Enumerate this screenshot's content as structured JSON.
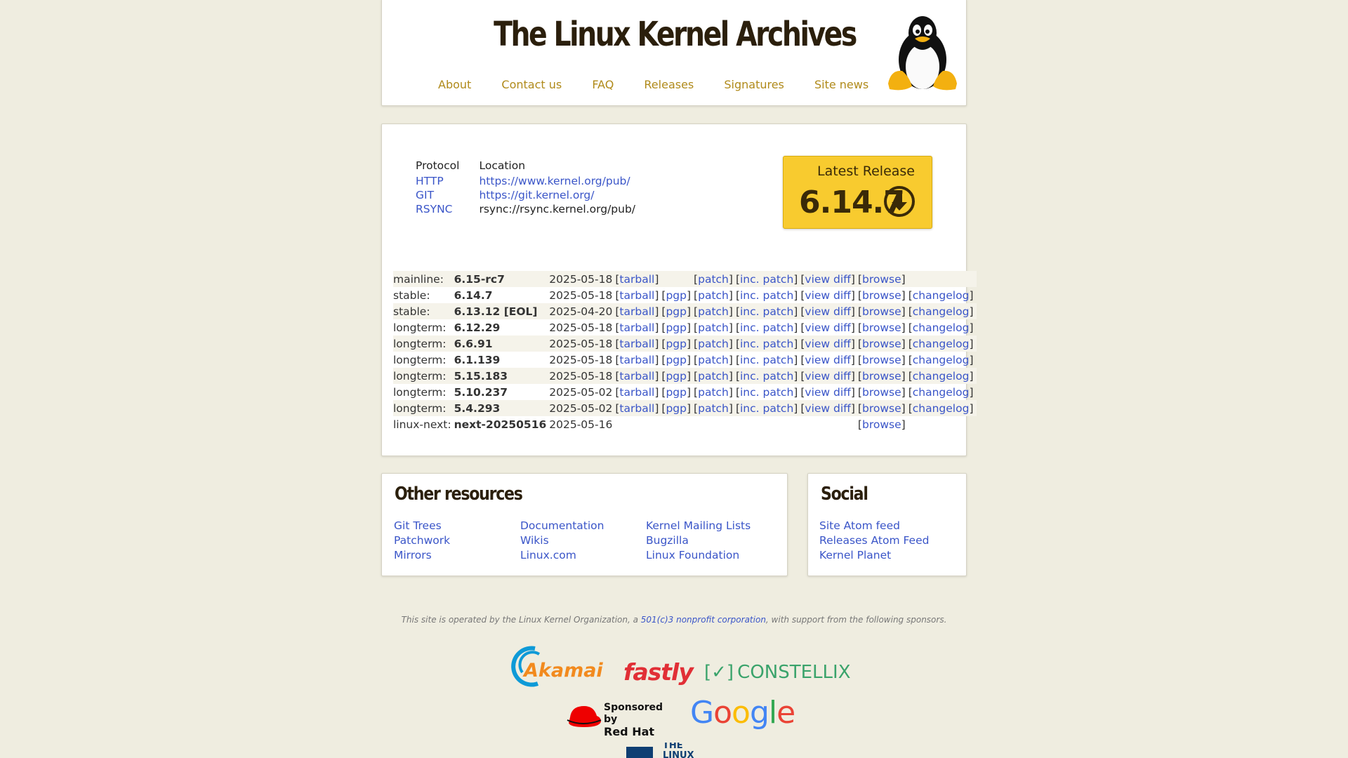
{
  "header": {
    "title": "The Linux Kernel Archives",
    "nav": [
      "About",
      "Contact us",
      "FAQ",
      "Releases",
      "Signatures",
      "Site news"
    ]
  },
  "protocols": {
    "headers": [
      "Protocol",
      "Location"
    ],
    "rows": [
      {
        "protocol": "HTTP",
        "location": "https://www.kernel.org/pub/"
      },
      {
        "protocol": "GIT",
        "location": "https://git.kernel.org/"
      },
      {
        "protocol": "RSYNC",
        "location": "rsync://rsync.kernel.org/pub/"
      }
    ]
  },
  "latest": {
    "label": "Latest Release",
    "version": "6.14.7"
  },
  "releases": [
    {
      "branch": "mainline:",
      "version": "6.15-rc7",
      "date": "2025-05-18",
      "links": [
        "tarball",
        "",
        "patch",
        "inc. patch",
        "view diff",
        "browse",
        ""
      ]
    },
    {
      "branch": "stable:",
      "version": "6.14.7",
      "date": "2025-05-18",
      "links": [
        "tarball",
        "pgp",
        "patch",
        "inc. patch",
        "view diff",
        "browse",
        "changelog"
      ]
    },
    {
      "branch": "stable:",
      "version": "6.13.12 [EOL]",
      "date": "2025-04-20",
      "links": [
        "tarball",
        "pgp",
        "patch",
        "inc. patch",
        "view diff",
        "browse",
        "changelog"
      ]
    },
    {
      "branch": "longterm:",
      "version": "6.12.29",
      "date": "2025-05-18",
      "links": [
        "tarball",
        "pgp",
        "patch",
        "inc. patch",
        "view diff",
        "browse",
        "changelog"
      ]
    },
    {
      "branch": "longterm:",
      "version": "6.6.91",
      "date": "2025-05-18",
      "links": [
        "tarball",
        "pgp",
        "patch",
        "inc. patch",
        "view diff",
        "browse",
        "changelog"
      ]
    },
    {
      "branch": "longterm:",
      "version": "6.1.139",
      "date": "2025-05-18",
      "links": [
        "tarball",
        "pgp",
        "patch",
        "inc. patch",
        "view diff",
        "browse",
        "changelog"
      ]
    },
    {
      "branch": "longterm:",
      "version": "5.15.183",
      "date": "2025-05-18",
      "links": [
        "tarball",
        "pgp",
        "patch",
        "inc. patch",
        "view diff",
        "browse",
        "changelog"
      ]
    },
    {
      "branch": "longterm:",
      "version": "5.10.237",
      "date": "2025-05-02",
      "links": [
        "tarball",
        "pgp",
        "patch",
        "inc. patch",
        "view diff",
        "browse",
        "changelog"
      ]
    },
    {
      "branch": "longterm:",
      "version": "5.4.293",
      "date": "2025-05-02",
      "links": [
        "tarball",
        "pgp",
        "patch",
        "inc. patch",
        "view diff",
        "browse",
        "changelog"
      ]
    },
    {
      "branch": "linux-next:",
      "version": "next-20250516",
      "date": "2025-05-16",
      "links": [
        "",
        "",
        "",
        "",
        "",
        "browse",
        ""
      ]
    }
  ],
  "other_resources": {
    "title": "Other resources",
    "columns": [
      [
        "Git Trees",
        "Patchwork",
        "Mirrors"
      ],
      [
        "Documentation",
        "Wikis",
        "Linux.com"
      ],
      [
        "Kernel Mailing Lists",
        "Bugzilla",
        "Linux Foundation"
      ]
    ]
  },
  "social": {
    "title": "Social",
    "links": [
      "Site Atom feed",
      "Releases Atom Feed",
      "Kernel Planet"
    ]
  },
  "footer": {
    "text_before": "This site is operated by the Linux Kernel Organization, a ",
    "link": "501(c)3 nonprofit corporation",
    "text_after": ", with support from the following sponsors."
  },
  "sponsors": {
    "akamai": "Akamai",
    "fastly": "fastly",
    "constellix": "CONSTELLIX",
    "redhat_line1": "Sponsored by",
    "redhat_line2": "Red Hat",
    "google": "Google",
    "linux_foundation": "THE LINUX"
  },
  "colors": {
    "background": "#efede0",
    "nav_link": "#b08a1a",
    "link": "#3a55c8",
    "latest_button": "#f8cb2f"
  }
}
